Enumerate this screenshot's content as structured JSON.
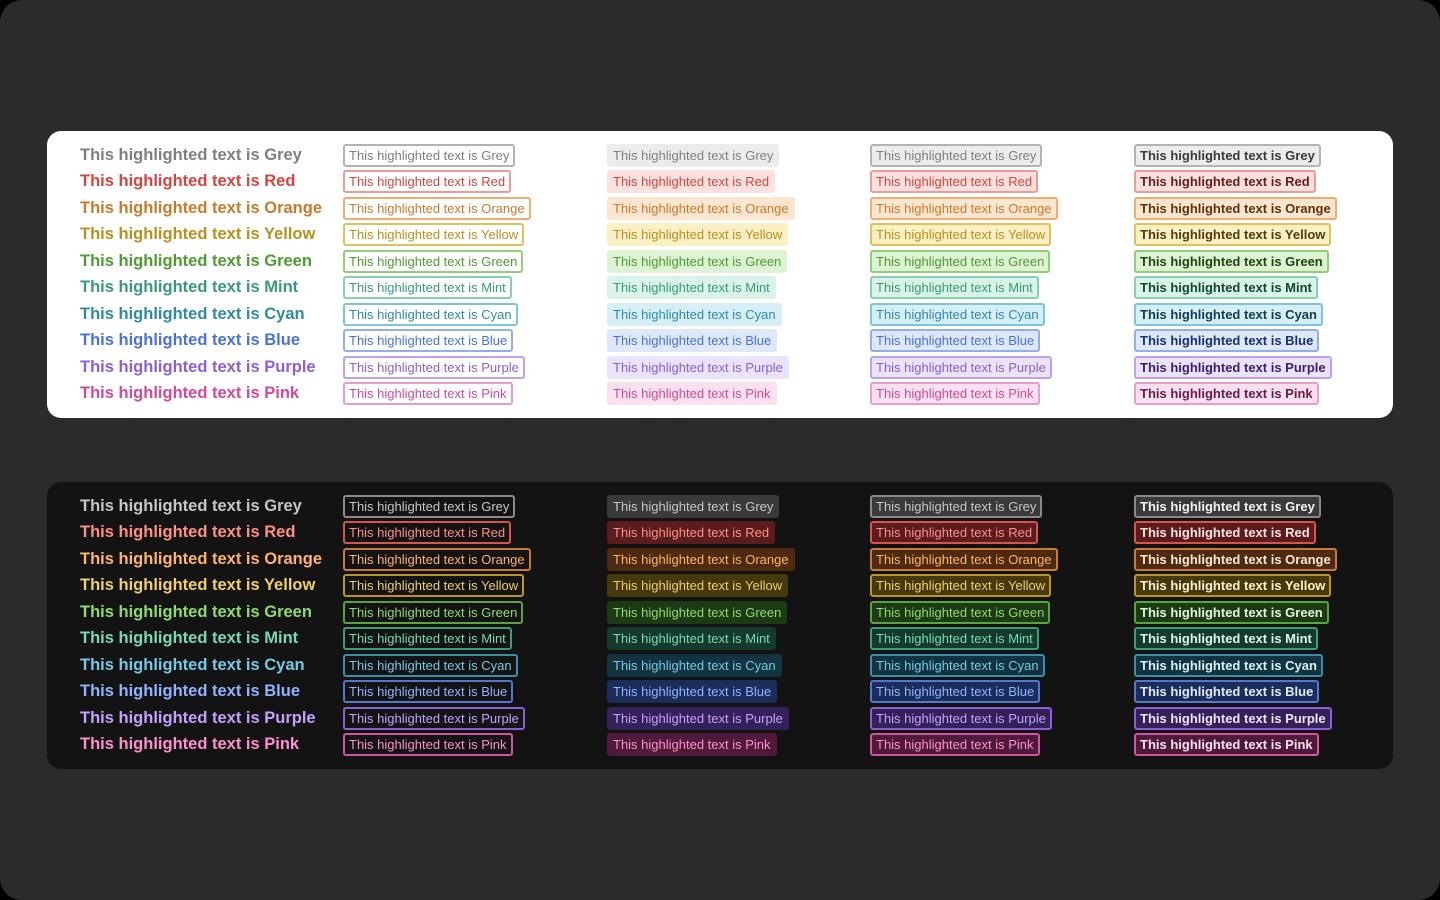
{
  "colors": {
    "Grey": {
      "light_text": "#7f7f7f",
      "light_bg": "#ececec",
      "light_border": "#b3b3b3",
      "light_strong": "#3a3a3a",
      "dark_text": "#c7c7c7",
      "dark_bg": "#3a3a3a",
      "dark_border": "#8a8a8a",
      "dark_strong": "#f2f2f2"
    },
    "Red": {
      "light_text": "#d3453f",
      "light_bg": "#fde1df",
      "light_border": "#ee9a95",
      "light_strong": "#6a1c18",
      "dark_text": "#ff8f87",
      "dark_bg": "#5a1c1c",
      "dark_border": "#d9544d",
      "dark_strong": "#ffe1de"
    },
    "Orange": {
      "light_text": "#c97a2c",
      "light_bg": "#fde6cf",
      "light_border": "#eeae70",
      "light_strong": "#5c320a",
      "dark_text": "#ffb36b",
      "dark_bg": "#4e2b10",
      "dark_border": "#c97a3a",
      "dark_strong": "#ffe8d3"
    },
    "Yellow": {
      "light_text": "#b9901e",
      "light_bg": "#fbefc4",
      "light_border": "#e2c15a",
      "light_strong": "#4f3c06",
      "dark_text": "#f0cf6a",
      "dark_bg": "#45390d",
      "dark_border": "#b9952e",
      "dark_strong": "#fff3cf"
    },
    "Green": {
      "light_text": "#4d9b32",
      "light_bg": "#def3d4",
      "light_border": "#92cd7a",
      "light_strong": "#1f4512",
      "dark_text": "#8fdb6f",
      "dark_bg": "#1c3a14",
      "dark_border": "#5aa33f",
      "dark_strong": "#e2f7d8"
    },
    "Mint": {
      "light_text": "#3a9a76",
      "light_bg": "#d9f3e8",
      "light_border": "#86d0b2",
      "light_strong": "#124533",
      "dark_text": "#7ad9b3",
      "dark_bg": "#133a2d",
      "dark_border": "#3e9c79",
      "dark_strong": "#dcf7ec"
    },
    "Cyan": {
      "light_text": "#2f8aa6",
      "light_bg": "#d6eff6",
      "light_border": "#7cc6dc",
      "light_strong": "#0f3c4b",
      "dark_text": "#74c9e6",
      "dark_bg": "#12333f",
      "dark_border": "#3c8ea8",
      "dark_strong": "#d9f1f9"
    },
    "Blue": {
      "light_text": "#4a72d6",
      "light_bg": "#dfe7fb",
      "light_border": "#93aeeb",
      "light_strong": "#18306e",
      "dark_text": "#93b2ff",
      "dark_bg": "#1b2d5a",
      "dark_border": "#5377d1",
      "dark_strong": "#e0e8ff"
    },
    "Purple": {
      "light_text": "#8b5fd6",
      "light_bg": "#ebe2fb",
      "light_border": "#bda0ee",
      "light_strong": "#3b1f6e",
      "dark_text": "#c3a1ff",
      "dark_bg": "#35215a",
      "dark_border": "#8a5fd1",
      "dark_strong": "#efe4ff"
    },
    "Pink": {
      "light_text": "#d04a9a",
      "light_bg": "#fbe0ef",
      "light_border": "#ea9ccb",
      "light_strong": "#6a1b4a",
      "dark_text": "#ff8fcf",
      "dark_bg": "#4f1a3a",
      "dark_border": "#cf559c",
      "dark_strong": "#ffe0f1"
    }
  },
  "rows": [
    {
      "key": "Grey",
      "text": "This highlighted text is Grey"
    },
    {
      "key": "Red",
      "text": "This highlighted text is Red"
    },
    {
      "key": "Orange",
      "text": "This highlighted text is Orange"
    },
    {
      "key": "Yellow",
      "text": "This highlighted text is Yellow"
    },
    {
      "key": "Green",
      "text": "This highlighted text is Green"
    },
    {
      "key": "Mint",
      "text": "This highlighted text is Mint"
    },
    {
      "key": "Cyan",
      "text": "This highlighted text is Cyan"
    },
    {
      "key": "Blue",
      "text": "This highlighted text is Blue"
    },
    {
      "key": "Purple",
      "text": "This highlighted text is Purple"
    },
    {
      "key": "Pink",
      "text": "This highlighted text is Pink"
    }
  ]
}
